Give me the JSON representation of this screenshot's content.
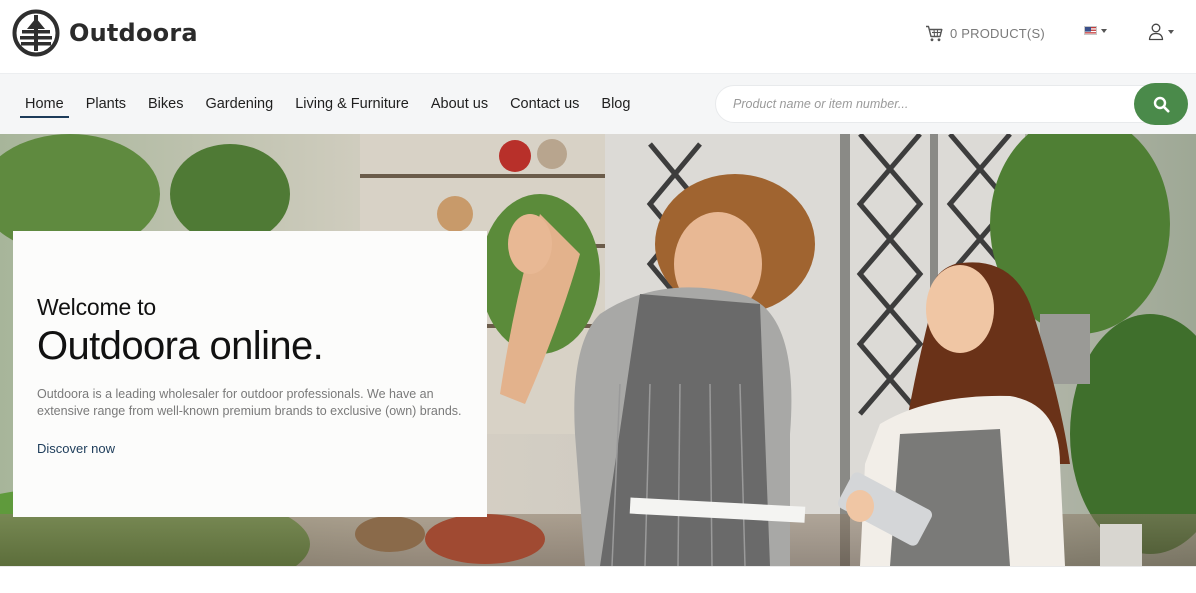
{
  "brand": {
    "name": "Outdoora",
    "logo_icon": "tree-in-circle-icon"
  },
  "header": {
    "cart_label": "0 PRODUCT(S)",
    "cart_icon": "cart-icon",
    "language_icon": "us-flag-icon",
    "account_icon": "user-icon"
  },
  "nav": {
    "items": [
      {
        "label": "Home",
        "active": true
      },
      {
        "label": "Plants"
      },
      {
        "label": "Bikes"
      },
      {
        "label": "Gardening"
      },
      {
        "label": "Living & Furniture"
      },
      {
        "label": "About us"
      },
      {
        "label": "Contact us"
      },
      {
        "label": "Blog"
      }
    ]
  },
  "search": {
    "placeholder": "Product name or item number...",
    "value": "",
    "icon": "search-icon"
  },
  "hero": {
    "kicker": "Welcome to",
    "title": "Outdoora online.",
    "text": "Outdoora is a leading wholesaler for outdoor professionals. We have an extensive range from well-known premium brands to exclusive (own) brands.",
    "link": "Discover now"
  },
  "colors": {
    "accent_green": "#4a8a4a",
    "nav_active_underline": "#1d3c5a",
    "link_blue": "#1d3c5a",
    "nav_bg": "#f5f6f7"
  }
}
